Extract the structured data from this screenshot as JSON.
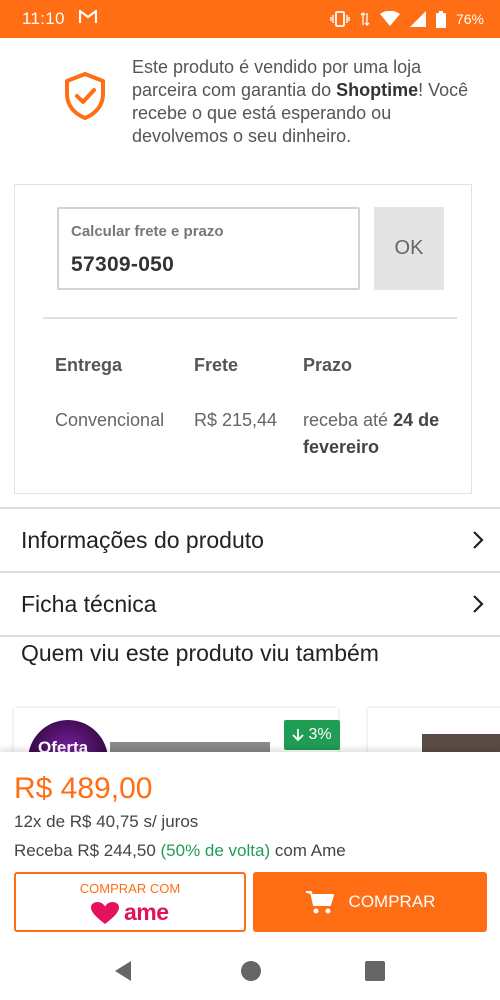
{
  "status_bar": {
    "time": "11:10",
    "mail_icon": "gmail-icon",
    "battery": "76%",
    "background": "#ff6e14"
  },
  "guarantee": {
    "icon": "shield-check-icon",
    "text_before": "Este produto é vendido por uma loja parceira com garantia do ",
    "brand": "Shoptime",
    "text_after": "! Você recebe o que está esperando ou devolvemos o seu dinheiro."
  },
  "shipping": {
    "cep_label": "Calcular frete e prazo",
    "cep_value": "57309-050",
    "ok_label": "OK",
    "headers": {
      "entrega": "Entrega",
      "frete": "Frete",
      "prazo": "Prazo"
    },
    "row": {
      "entrega": "Convencional",
      "frete": "R$ 215,44",
      "prazo_prefix": "receba até ",
      "prazo_date": "24 de fevereiro"
    }
  },
  "sections": {
    "product_info": "Informações do produto",
    "tech_sheet": "Ficha técnica",
    "also_viewed": "Quem viu este produto viu também"
  },
  "carousel": {
    "offer_badge": "Oferta",
    "discount": "3%"
  },
  "price_bar": {
    "price": "R$ 489,00",
    "installments": "12x de R$ 40,75 s/ juros",
    "cashback_prefix": "Receba R$ 244,50 ",
    "cashback_highlight": "(50% de volta)",
    "cashback_suffix": " com Ame",
    "ame_button_label": "COMPRAR COM",
    "ame_logo_text": "ame",
    "buy_button_label": "COMPRAR",
    "accent": "#ff6e14",
    "green": "#1f9d55"
  }
}
